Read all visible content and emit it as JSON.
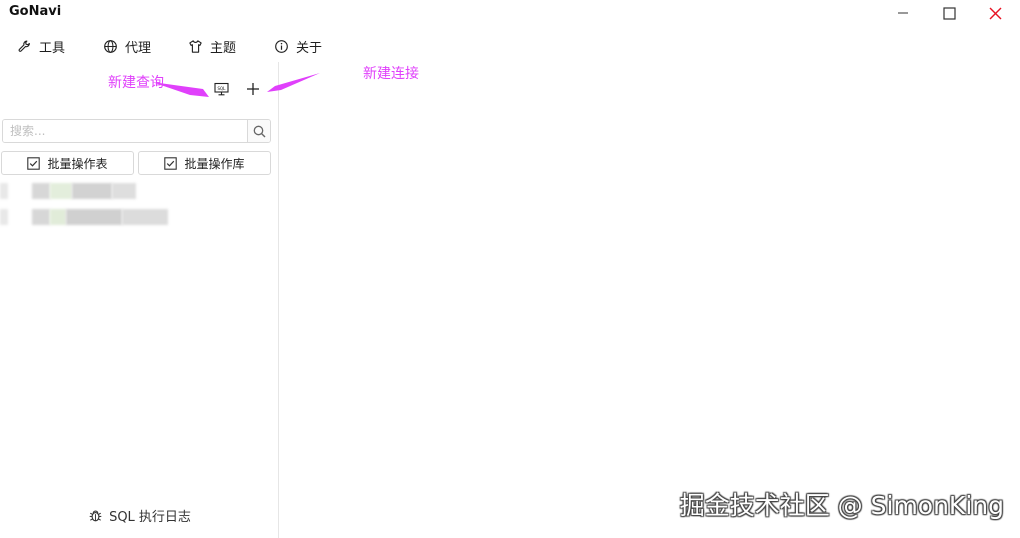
{
  "app": {
    "title": "GoNavi"
  },
  "menu": [
    {
      "label": "工具",
      "icon": "wrench-icon"
    },
    {
      "label": "代理",
      "icon": "globe-icon"
    },
    {
      "label": "主题",
      "icon": "shirt-icon"
    },
    {
      "label": "关于",
      "icon": "info-icon"
    }
  ],
  "sidebar": {
    "toolbar": [
      {
        "icon": "sql-query-icon"
      },
      {
        "icon": "plus-icon"
      }
    ],
    "search": {
      "placeholder": "搜索..."
    },
    "batch": {
      "tables_label": "批量操作表",
      "databases_label": "批量操作库"
    },
    "footer": {
      "sql_log_label": "SQL 执行日志",
      "icon": "bug-icon"
    }
  },
  "annotations": {
    "new_query": "新建查询",
    "new_connection": "新建连接",
    "color": "#e040fb"
  },
  "watermark": "掘金技术社区 @ SimonKing",
  "colors": {
    "close": "#e81123",
    "border": "#d9d9d9",
    "annotation": "#e040fb"
  }
}
